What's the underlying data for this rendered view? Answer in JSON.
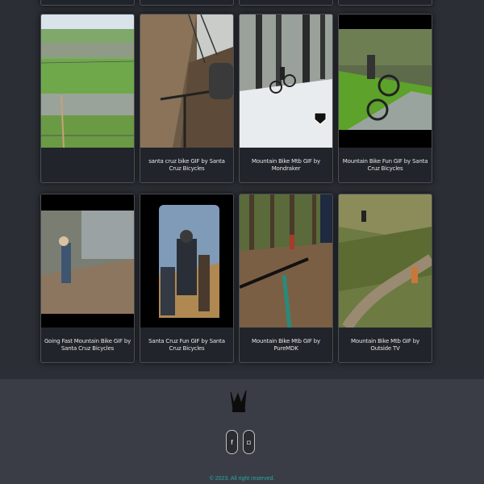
{
  "gifs": [
    {
      "caption": ""
    },
    {
      "caption": "santa cruz bike GIF by Santa Cruz Bicycles"
    },
    {
      "caption": "Mountain Bike Mtb GIF by Mondraker"
    },
    {
      "caption": "Mountain Bike Fun GIF by Santa Cruz Bicycles"
    },
    {
      "caption": "Going Fast Mountain Bike GIF by Santa Cruz Bicycles"
    },
    {
      "caption": "Santa Cruz Fun GIF by Santa Cruz Bicycles"
    },
    {
      "caption": "Mountain Bike Mtb GIF by PureMDK"
    },
    {
      "caption": "Mountain Bike Mtb GIF by Outside TV"
    }
  ],
  "footer": {
    "logo_icon": "crown-logo-icon",
    "social": [
      {
        "icon": "facebook-icon",
        "glyph": "f"
      },
      {
        "icon": "instagram-icon",
        "glyph": "◘"
      }
    ],
    "copyright": "© 2023. All right reserved."
  },
  "colors": {
    "page_bg": "#2b2e34",
    "card_bg": "#21252b",
    "footer_bg": "#3a3d45",
    "accent": "#2aa6a0"
  }
}
